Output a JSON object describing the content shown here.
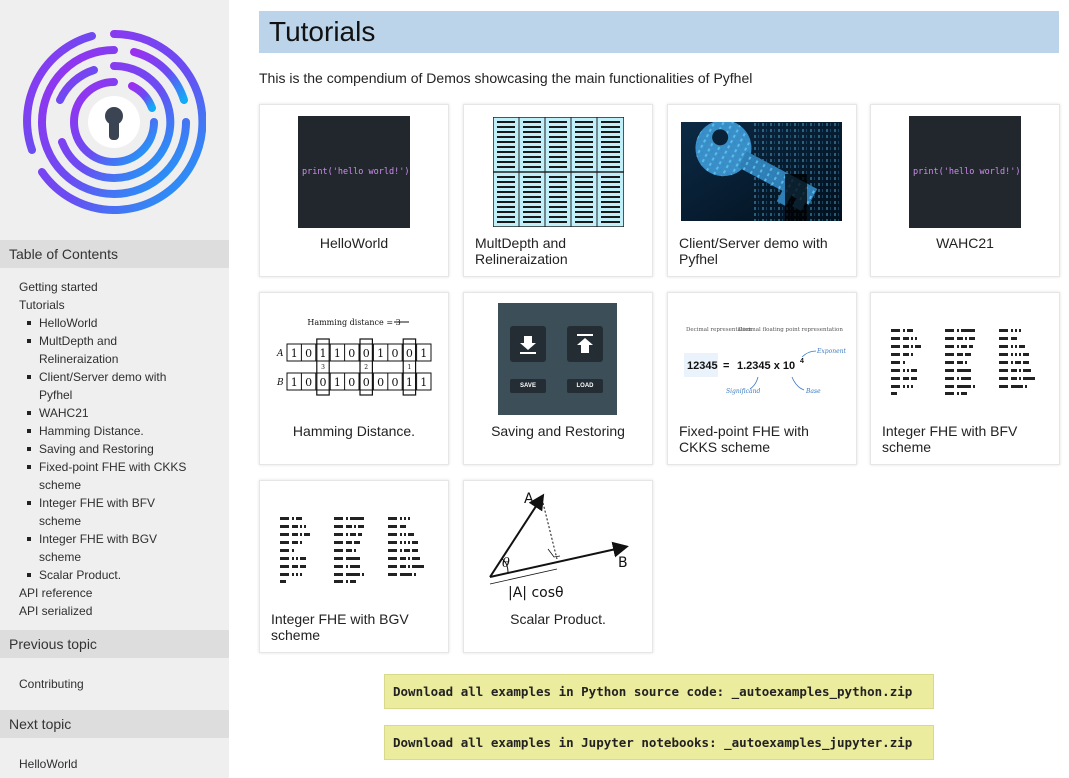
{
  "sidebar": {
    "toc_title": "Table of Contents",
    "toc": {
      "getting_started": "Getting started",
      "tutorials": "Tutorials",
      "items": [
        "HelloWorld",
        "MultDepth and Relineraization",
        "Client/Server demo with Pyfhel",
        "WAHC21",
        "Hamming Distance.",
        "Saving and Restoring",
        "Fixed-point FHE with CKKS scheme",
        "Integer FHE with BFV scheme",
        "Integer FHE with BGV scheme",
        "Scalar Product."
      ],
      "api_reference": "API reference",
      "api_serialized": "API serialized"
    },
    "previous_title": "Previous topic",
    "previous_link": "Contributing",
    "next_title": "Next topic",
    "next_link": "HelloWorld"
  },
  "main": {
    "title": "Tutorials",
    "intro": "This is the compendium of Demos showcasing the main functionalities of Pyfhel",
    "cards": [
      {
        "label": "HelloWorld",
        "code": "print('hello world!')"
      },
      {
        "label": "MultDepth and Relineraization"
      },
      {
        "label": "Client/Server demo with Pyfhel"
      },
      {
        "label": "WAHC21",
        "code": "print('hello world!')"
      },
      {
        "label": "Hamming Distance.",
        "caption": "Hamming distance = 3",
        "row_a": "A",
        "row_b": "B",
        "bits_a": [
          "1",
          "0",
          "1",
          "1",
          "0",
          "0",
          "1",
          "0",
          "0",
          "1"
        ],
        "bits_b": [
          "1",
          "0",
          "0",
          "1",
          "0",
          "0",
          "0",
          "0",
          "1",
          "1"
        ],
        "marks": [
          "3",
          "2",
          "1"
        ]
      },
      {
        "label": "Saving and Restoring",
        "save": "SAVE",
        "load": "LOAD"
      },
      {
        "label": "Fixed-point FHE with CKKS scheme",
        "decimal_rep": "Decimal representation",
        "decimal_float": "Decimal floating point representation",
        "left": "12345",
        "eq": "=",
        "right": "1.2345 x 10",
        "exp": "4",
        "exponent": "Exponent",
        "significand": "Significand",
        "base": "Base"
      },
      {
        "label": "Integer FHE with BFV scheme"
      },
      {
        "label": "Integer FHE with BGV scheme"
      },
      {
        "label": "Scalar Product.",
        "a": "A",
        "b": "B",
        "theta": "θ",
        "formula": "|A| cosθ"
      }
    ],
    "downloads": [
      "Download all examples in Python source code: _autoexamples_python.zip",
      "Download all examples in Jupyter notebooks: _autoexamples_jupyter.zip"
    ]
  },
  "colors": {
    "title_bar": "#bcd4ea",
    "sidebar_bg": "#efefef",
    "download_bg": "#ecec9e",
    "logo_purple": "#8b2fe8",
    "logo_blue": "#1f9ef5"
  }
}
